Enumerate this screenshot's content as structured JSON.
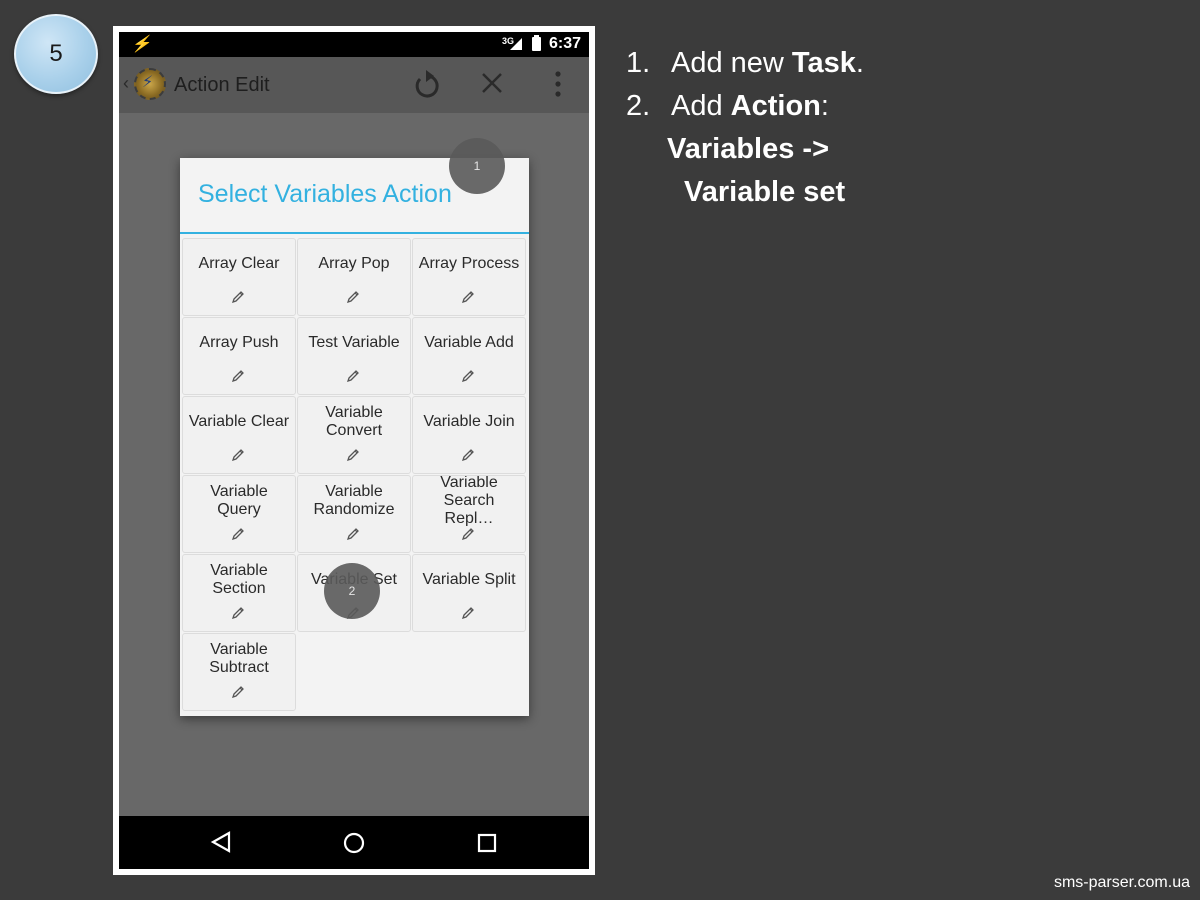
{
  "slide": {
    "step_number": "5",
    "footer": "sms-parser.com.ua"
  },
  "instructions": {
    "item1": {
      "number": "1.",
      "prefix": "Add new ",
      "bold": "Task",
      "suffix": "."
    },
    "item2": {
      "number": "2.",
      "prefix": "Add ",
      "bold": "Action",
      "suffix": ":"
    },
    "path_line1": "Variables ->",
    "path_line2": "Variable set"
  },
  "phone": {
    "status_bar": {
      "network": "3G",
      "time": "6:37"
    },
    "app_bar": {
      "title": "Action Edit",
      "icons": [
        "back-chevron-icon",
        "app-icon",
        "undo-icon",
        "close-icon",
        "more-vert-icon"
      ]
    },
    "dialog": {
      "title": "Select Variables Action",
      "actions": [
        {
          "label": "Array Clear"
        },
        {
          "label": "Array Pop"
        },
        {
          "label": "Array Process"
        },
        {
          "label": "Array Push"
        },
        {
          "label": "Test Variable"
        },
        {
          "label": "Variable Add"
        },
        {
          "label": "Variable Clear"
        },
        {
          "label": "Variable Convert"
        },
        {
          "label": "Variable Join"
        },
        {
          "label": "Variable Query"
        },
        {
          "label": "Variable Randomize"
        },
        {
          "label": "Variable Search Repl…"
        },
        {
          "label": "Variable Section"
        },
        {
          "label": "Variable Set"
        },
        {
          "label": "Variable Split"
        },
        {
          "label": "Variable Subtract"
        }
      ]
    },
    "touch_markers": [
      {
        "label": "1"
      },
      {
        "label": "2"
      }
    ],
    "nav_bar": {
      "icons": [
        "nav-back-icon",
        "nav-home-icon",
        "nav-recents-icon"
      ]
    },
    "colors": {
      "accent": "#33b1e0",
      "dim_background": "#686868",
      "dialog_bg": "#f3f3f3"
    }
  }
}
